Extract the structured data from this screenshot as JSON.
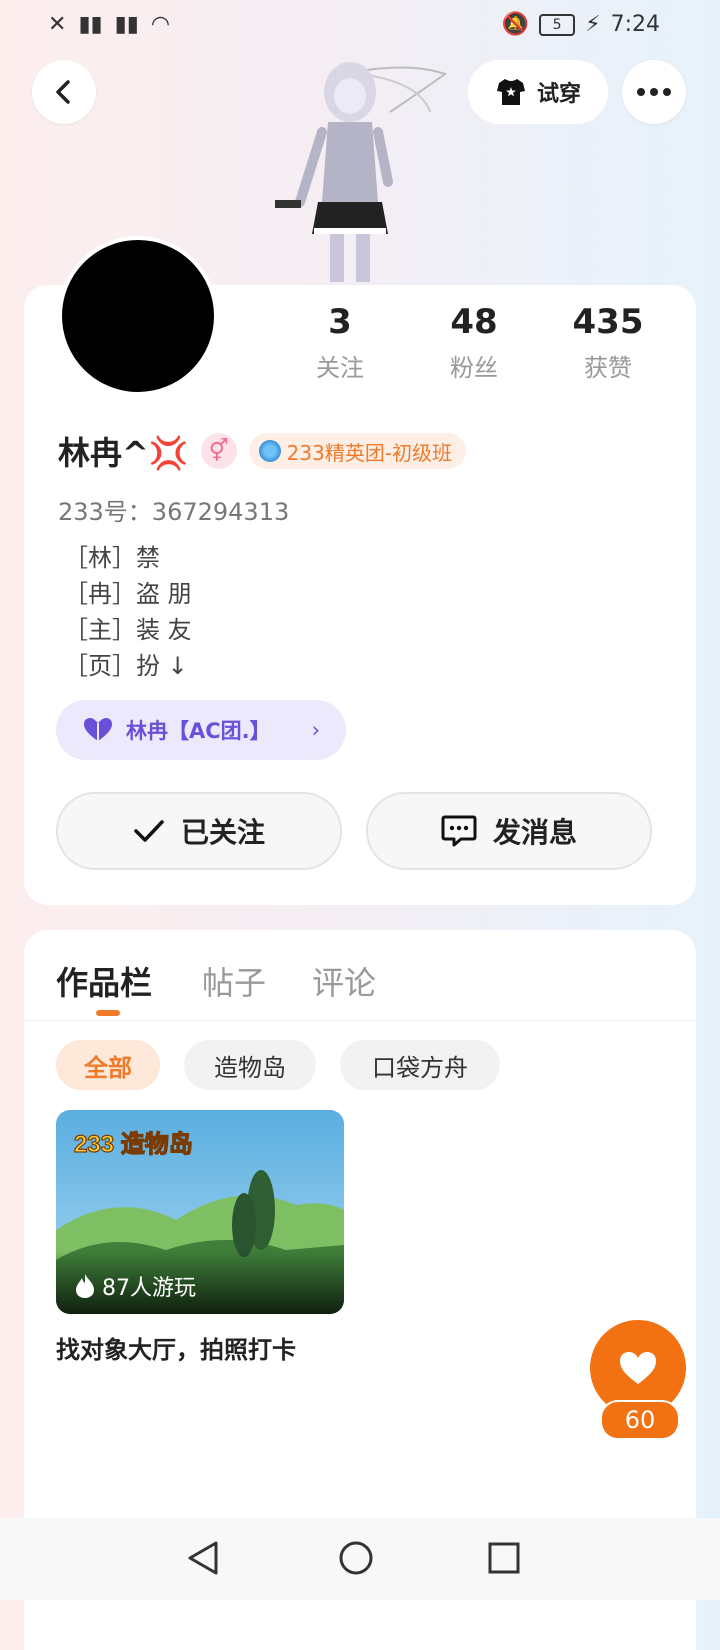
{
  "status_bar": {
    "time": "7:24",
    "battery": "5"
  },
  "header": {
    "try_on_label": "试穿"
  },
  "stats": [
    {
      "value": "3",
      "label": "关注"
    },
    {
      "value": "48",
      "label": "粉丝"
    },
    {
      "value": "435",
      "label": "获赞"
    }
  ],
  "profile": {
    "name": "林冉^💢",
    "gender_symbol": "⚥",
    "badge": "233精英团-初级班",
    "uid": "233号：367294313",
    "bio": [
      "［林］禁",
      "［冉］盗 朋",
      "［主］装 友",
      "［页］扮 ↓"
    ],
    "group_label": "林冉【AC团.】"
  },
  "actions": {
    "follow_label": "已关注",
    "message_label": "发消息"
  },
  "tabs": [
    "作品栏",
    "帖子",
    "评论"
  ],
  "filters": [
    "全部",
    "造物岛",
    "口袋方舟"
  ],
  "works": [
    {
      "logo": "233 造物岛",
      "plays": "87人游玩",
      "title": "找对象大厅，拍照打卡"
    }
  ],
  "like": {
    "count": "60"
  }
}
